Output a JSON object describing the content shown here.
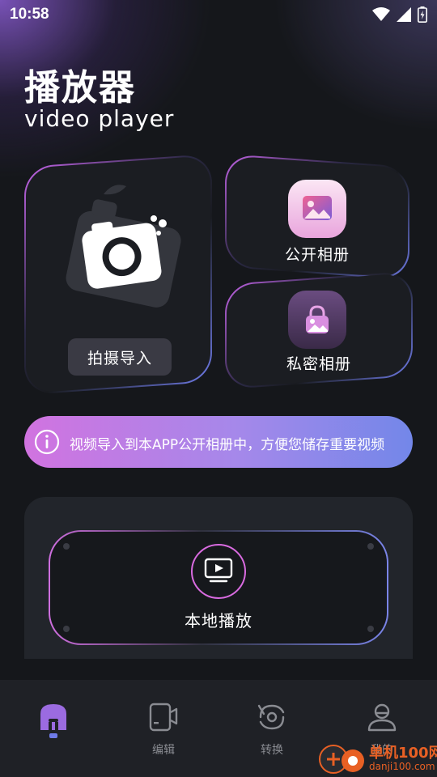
{
  "status_bar": {
    "time": "10:58",
    "icons": [
      "wifi-icon",
      "signal-icon",
      "battery-charging-icon"
    ]
  },
  "header": {
    "title": "播放器",
    "subtitle": "video player"
  },
  "cards": {
    "capture": {
      "label": "拍摄导入",
      "icon": "camera-icon"
    },
    "public_album": {
      "label": "公开相册",
      "icon": "picture-icon"
    },
    "private_album": {
      "label": "私密相册",
      "icon": "locked-picture-icon"
    }
  },
  "info_banner": {
    "icon": "info-icon",
    "text": "视频导入到本APP公开相册中，方便您储存重要视频"
  },
  "local_play": {
    "label": "本地播放",
    "icon": "video-play-icon"
  },
  "bottom_nav": {
    "items": [
      {
        "label": "",
        "icon": "home-icon",
        "active": true
      },
      {
        "label": "编辑",
        "icon": "video-edit-icon",
        "active": false
      },
      {
        "label": "转换",
        "icon": "convert-icon",
        "active": false
      },
      {
        "label": "我的",
        "icon": "profile-icon",
        "active": false
      }
    ]
  },
  "watermark": {
    "text": "单机100网",
    "sub": "danji100.com"
  },
  "colors": {
    "accent_pink": "#d173e0",
    "accent_blue": "#7387e9",
    "background": "#15171b",
    "active_nav": "#9b6be0"
  }
}
